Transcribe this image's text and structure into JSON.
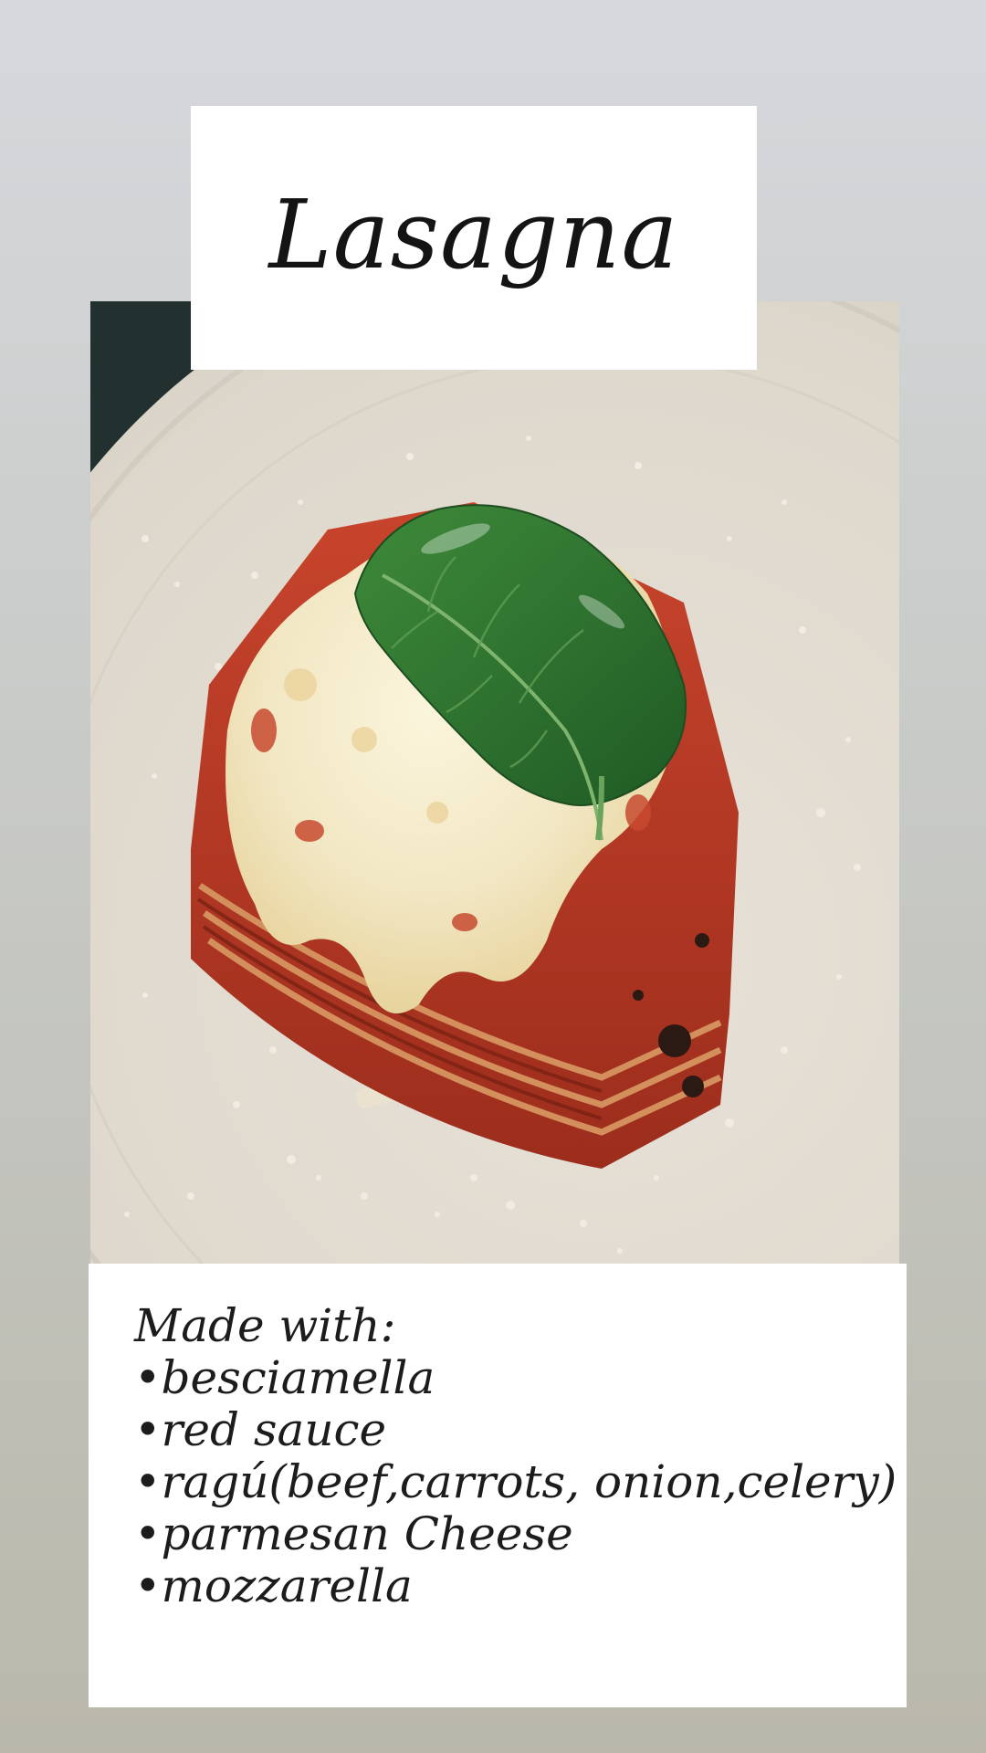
{
  "title": "Lasagna",
  "ingredients": {
    "heading": "Made with:",
    "items": [
      "•besciamella",
      "•red sauce",
      "•ragú(beef,carrots, onion,celery)",
      "•parmesan Cheese",
      "•mozzarella"
    ]
  },
  "colors": {
    "background_top": "#d6d8dc",
    "background_bottom": "#b9b8ab",
    "card": "#ffffff",
    "text": "#141414"
  }
}
